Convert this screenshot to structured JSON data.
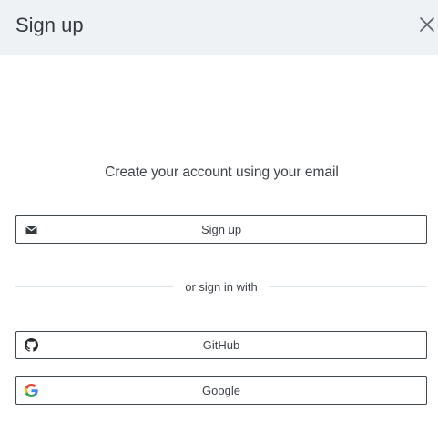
{
  "dialog": {
    "title": "Sign up",
    "close_icon": "close-icon"
  },
  "main": {
    "subtitle": "Create your account using your email",
    "email_button": {
      "label": "Sign up",
      "icon": "envelope-icon"
    },
    "divider_text": "or sign in with",
    "providers": [
      {
        "label": "GitHub",
        "icon": "github-icon"
      },
      {
        "label": "Google",
        "icon": "google-icon"
      }
    ]
  },
  "colors": {
    "header_bg": "#eef2f5",
    "border": "#3f464c",
    "text": "#3d4349"
  }
}
